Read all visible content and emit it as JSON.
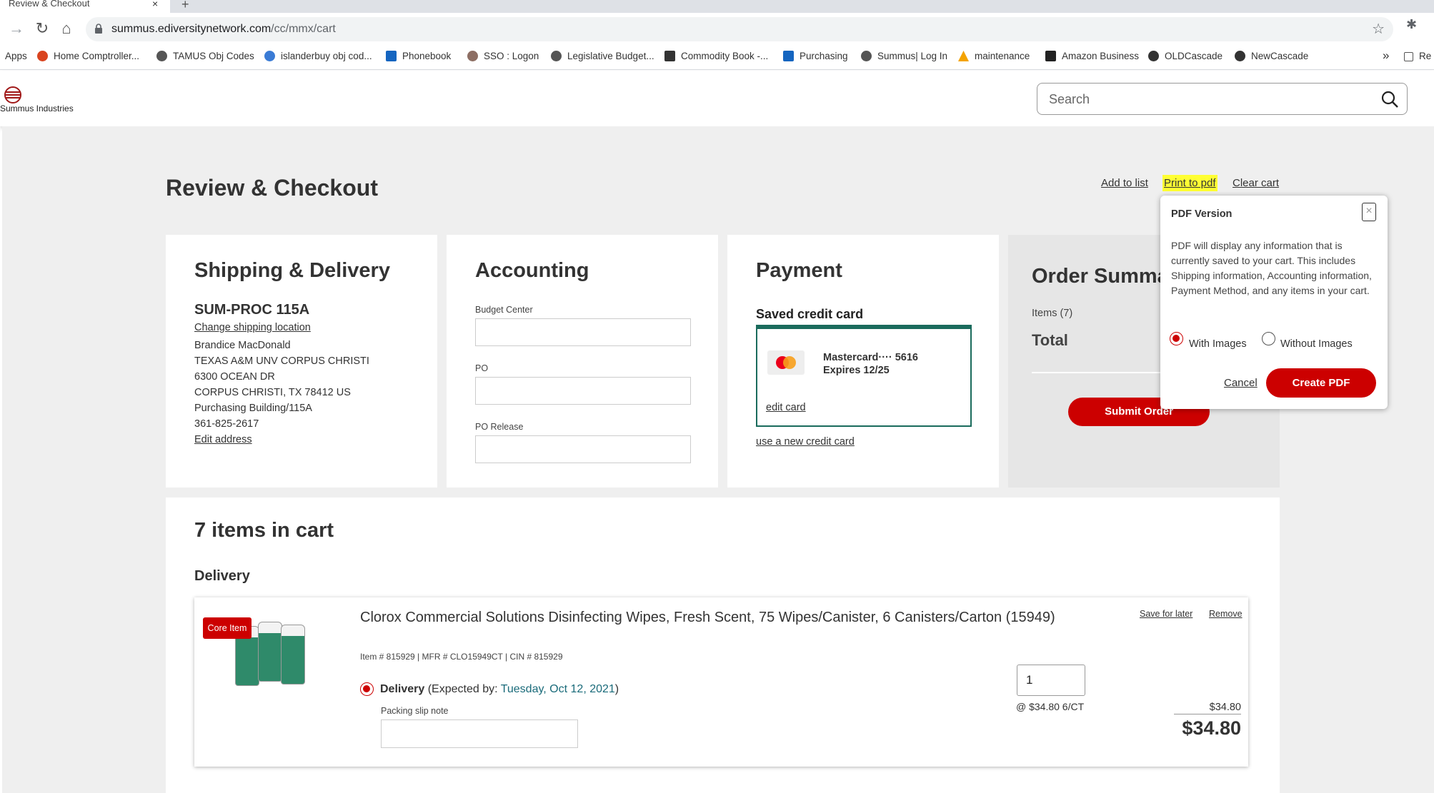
{
  "browser": {
    "tab_title": "Review & Checkout",
    "url_host": "summus.ediversitynetwork.com",
    "url_path": "/cc/mmx/cart",
    "bookmarks": [
      {
        "label": "Apps",
        "color": ""
      },
      {
        "label": "Home Comptroller...",
        "color": "#d9441f"
      },
      {
        "label": "TAMUS Obj Codes",
        "color": "#555555"
      },
      {
        "label": "islanderbuy obj cod...",
        "color": "#3a7bd5"
      },
      {
        "label": "Phonebook",
        "color": "#1565c0"
      },
      {
        "label": "SSO : Logon",
        "color": "#8d6e63"
      },
      {
        "label": "Legislative Budget...",
        "color": "#555555"
      },
      {
        "label": "Commodity Book -...",
        "color": "#333333"
      },
      {
        "label": "Purchasing",
        "color": "#1565c0"
      },
      {
        "label": "Summus| Log In",
        "color": "#555555"
      },
      {
        "label": "maintenance",
        "color": "#f4a300"
      },
      {
        "label": "Amazon Business",
        "color": "#222222"
      },
      {
        "label": "OLDCascade",
        "color": "#333333"
      },
      {
        "label": "NewCascade",
        "color": "#333333"
      }
    ],
    "bookmarks_more": "»",
    "reading_list": "Re"
  },
  "header": {
    "logo_text": "Summus Industries",
    "search_placeholder": "Search"
  },
  "page": {
    "title": "Review & Checkout",
    "links": {
      "add_to_list": "Add to list",
      "print_to_pdf": "Print to pdf",
      "clear_cart": "Clear cart"
    }
  },
  "shipping": {
    "heading": "Shipping & Delivery",
    "location": "SUM-PROC 115A",
    "change_link": "Change shipping location",
    "lines": [
      "Brandice MacDonald",
      "TEXAS A&M UNV CORPUS CHRISTI",
      "6300 OCEAN DR",
      "CORPUS CHRISTI, TX 78412 US",
      "Purchasing Building/115A",
      "361-825-2617"
    ],
    "edit_link": "Edit address"
  },
  "accounting": {
    "heading": "Accounting",
    "fields": [
      {
        "label": "Budget Center",
        "value": ""
      },
      {
        "label": "PO",
        "value": ""
      },
      {
        "label": "PO Release",
        "value": ""
      }
    ]
  },
  "payment": {
    "heading": "Payment",
    "subheading": "Saved credit card",
    "card_line1": "Mastercard···· 5616",
    "card_line2": "Expires 12/25",
    "edit_link": "edit card",
    "new_card_link": "use a new credit card"
  },
  "summary": {
    "heading": "Order Summa",
    "items_label": "Items (7)",
    "total_label": "Total",
    "submit_label": "Submit Order"
  },
  "pdf_popup": {
    "title": "PDF Version",
    "close": "×",
    "body": "PDF will display any information that is currently saved to your cart. This includes Shipping information, Accounting information, Payment Method, and any items in your cart.",
    "option_with": "With Images",
    "option_without": "Without Images",
    "selected": "with",
    "cancel": "Cancel",
    "create": "Create PDF"
  },
  "cart": {
    "heading": "7 items in cart",
    "section": "Delivery",
    "items": [
      {
        "badge": "Core Item",
        "name": "Clorox Commercial Solutions Disinfecting Wipes, Fresh Scent, 75 Wipes/Canister, 6 Canisters/Carton (15949)",
        "meta": "Item # 815929 | MFR # CLO15949CT | CIN # 815929",
        "delivery_label": "Delivery",
        "expected_prefix": "(Expected by: ",
        "expected_date": "Tuesday, Oct 12, 2021",
        "expected_suffix": ")",
        "note_label": "Packing slip note",
        "quantity": "1",
        "unit_price": "@ $34.80 6/CT",
        "line_price": "$34.80",
        "total": "$34.80",
        "save_link": "Save for later",
        "remove_link": "Remove"
      }
    ]
  },
  "colors": {
    "brand_red": "#cc0000",
    "teal": "#1a6b5c",
    "highlight": "#ffff33",
    "date_teal": "#1a6b7a"
  }
}
